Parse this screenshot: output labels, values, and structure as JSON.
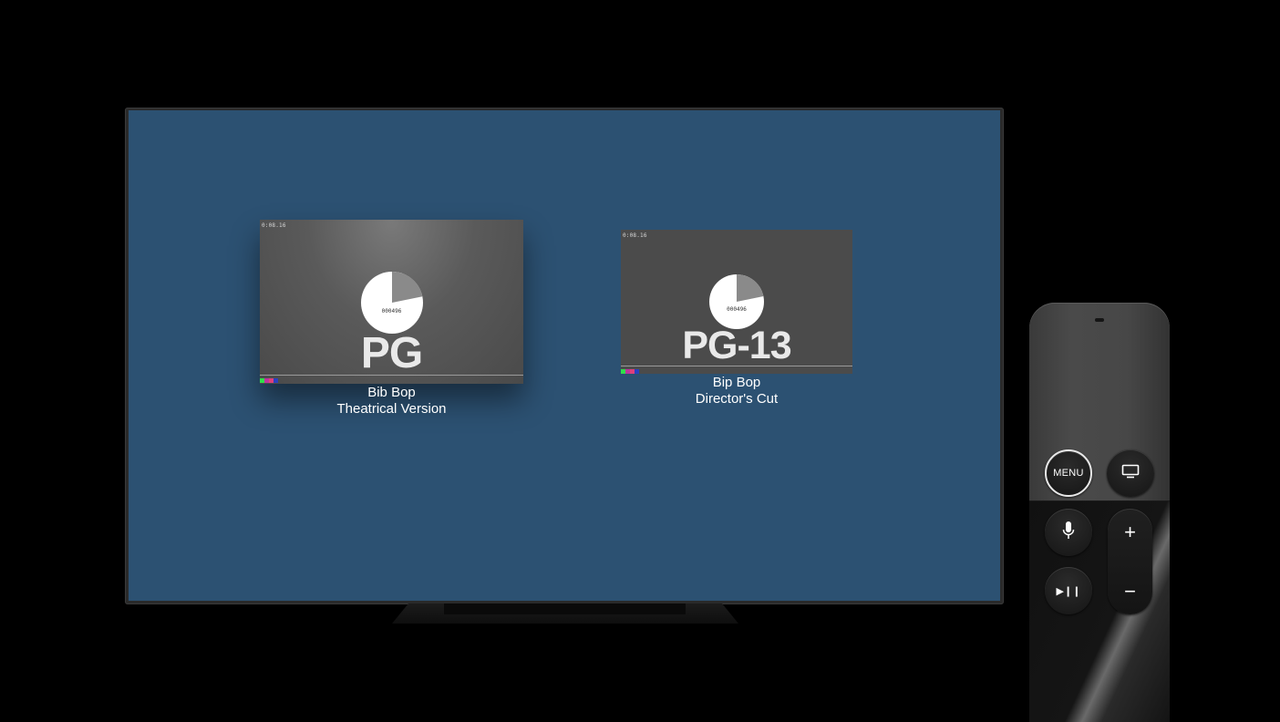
{
  "tiles": [
    {
      "timecode": "0:08.16",
      "frame_count": "000496",
      "rating": "PG",
      "caption_line1": "Bib Bop",
      "caption_line2": "Theatrical Version",
      "focused": true
    },
    {
      "timecode": "0:08.16",
      "frame_count": "000496",
      "rating": "PG-13",
      "caption_line1": "Bip Bop",
      "caption_line2": "Director's Cut",
      "focused": false
    }
  ],
  "colors": {
    "screen_background": "#2c5172",
    "thumbnail": "#4b4b4b",
    "color_bar": [
      "#2ee04a",
      "#c030a0",
      "#e0407a",
      "#2a40c0"
    ]
  },
  "remote": {
    "menu_label": "MENU",
    "plus_label": "+",
    "minus_label": "−",
    "play_pause_label": "▶︎❙❙",
    "icons": [
      "tv-icon",
      "microphone-icon",
      "play-pause-icon"
    ]
  }
}
